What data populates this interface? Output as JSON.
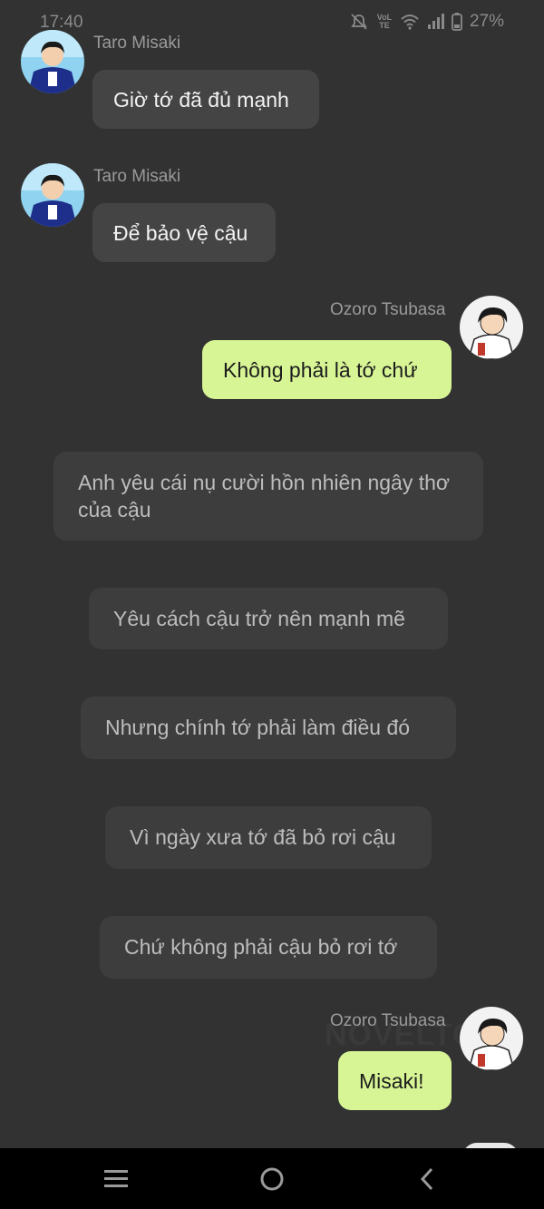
{
  "status_bar": {
    "time": "17:40",
    "network_label": "VoLTE",
    "battery_percent": "27%"
  },
  "messages": [
    {
      "sender": "Taro Misaki",
      "text": "Giờ tớ đã đủ mạnh"
    },
    {
      "sender": "Taro Misaki",
      "text": "Để bảo vệ cậu"
    },
    {
      "sender": "Ozoro Tsubasa",
      "text": "Không phải là tớ chứ"
    },
    {
      "sender": "Ozoro Tsubasa",
      "text": "Misaki!"
    }
  ],
  "narration": [
    "Anh yêu cái nụ cười hồn nhiên ngây thơ của cậu",
    "Yêu cách cậu trở nên mạnh mẽ",
    "Nhưng chính tớ phải làm điều đó",
    "Vì ngày xưa tớ đã bỏ rơi cậu",
    "Chứ không phải cậu bỏ rơi tớ"
  ],
  "watermark": "NOVELTO",
  "colors": {
    "background": "#323232",
    "incoming_bubble": "#444444",
    "outgoing_bubble": "#d7f595",
    "narration_bubble": "#3d3d3d"
  },
  "icons": {
    "nav_menu": "menu-icon",
    "nav_home": "home-circle-icon",
    "nav_back": "back-chevron-icon"
  }
}
